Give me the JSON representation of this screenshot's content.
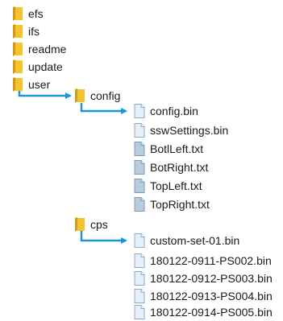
{
  "colors": {
    "connector": "#1a96d8",
    "folder": "#f4c430",
    "folder_dark": "#d89a12",
    "file": "#e6f0f8",
    "file_shaded": "#b8cce0"
  },
  "tree": {
    "root": [
      "efs",
      "ifs",
      "readme",
      "update",
      "user"
    ],
    "config": {
      "label": "config",
      "files": [
        "config.bin",
        "sswSettings.bin",
        "BotlLeft.txt",
        "BotRight.txt",
        "TopLeft.txt",
        "TopRight.txt"
      ]
    },
    "cps": {
      "label": "cps",
      "files": [
        "custom-set-01.bin",
        "180122-0911-PS002.bin",
        "180122-0912-PS003.bin",
        "180122-0913-PS004.bin",
        "180122-0914-PS005.bin"
      ]
    }
  },
  "icons": {
    "folder": "folder-icon",
    "file": "file-icon",
    "text_file": "text-file-icon"
  }
}
